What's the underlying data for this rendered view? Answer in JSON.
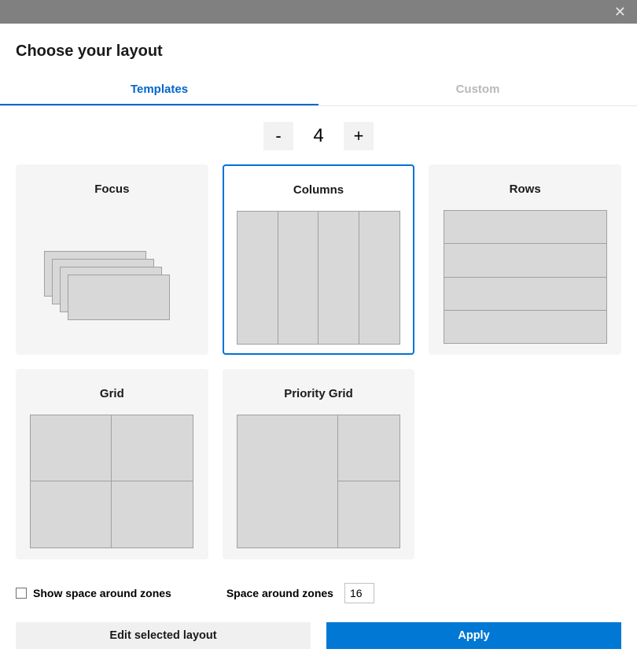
{
  "title": "Choose your layout",
  "tabs": {
    "templates": "Templates",
    "custom": "Custom",
    "active": "templates"
  },
  "stepper": {
    "minus": "-",
    "plus": "+",
    "value": "4"
  },
  "layouts": {
    "focus": "Focus",
    "columns": "Columns",
    "rows": "Rows",
    "grid": "Grid",
    "priority_grid": "Priority Grid",
    "selected": "columns"
  },
  "controls": {
    "show_space_label": "Show space around zones",
    "space_label": "Space around zones",
    "space_value": "16"
  },
  "buttons": {
    "edit": "Edit selected layout",
    "apply": "Apply"
  }
}
